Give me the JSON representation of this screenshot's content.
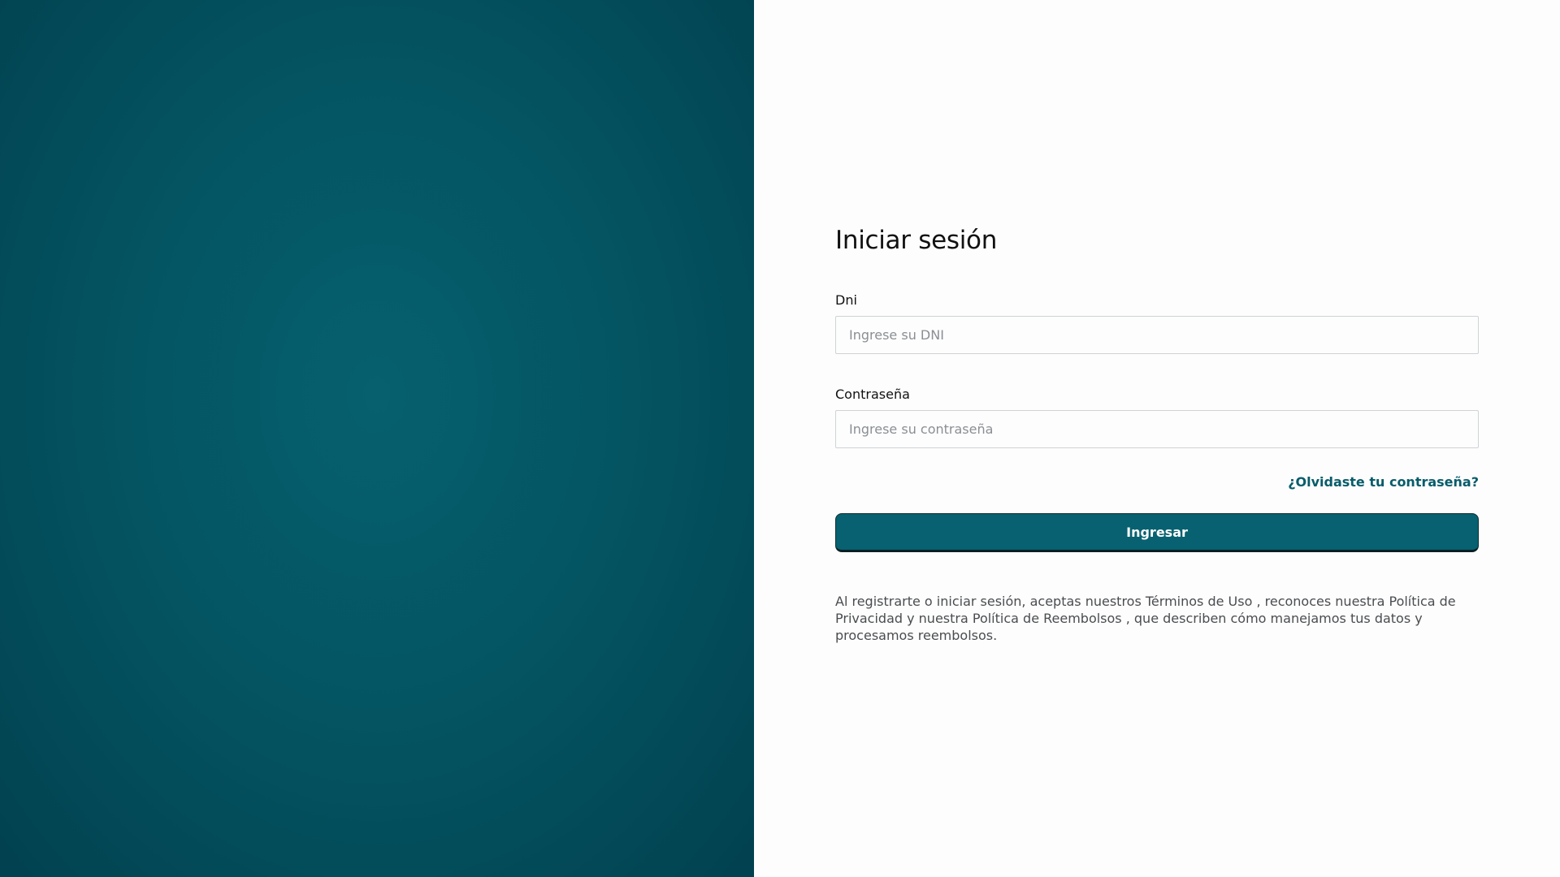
{
  "login": {
    "title": "Iniciar sesión",
    "dni_label": "Dni",
    "dni_placeholder": "Ingrese su DNI",
    "password_label": "Contraseña",
    "password_placeholder": "Ingrese su contraseña",
    "forgot_password": "¿Olvidaste tu contraseña?",
    "submit_label": "Ingresar",
    "legal_text": "Al registrarte o iniciar sesión, aceptas nuestros Términos de Uso , reconoces nuestra Política de Privacidad y nuestra Política de Reembolsos , que describen cómo manejamos tus datos y procesamos reembolsos."
  },
  "colors": {
    "left_panel": "#045563",
    "accent": "#076170",
    "link": "#075c6a",
    "background": "#fdfdfd"
  }
}
